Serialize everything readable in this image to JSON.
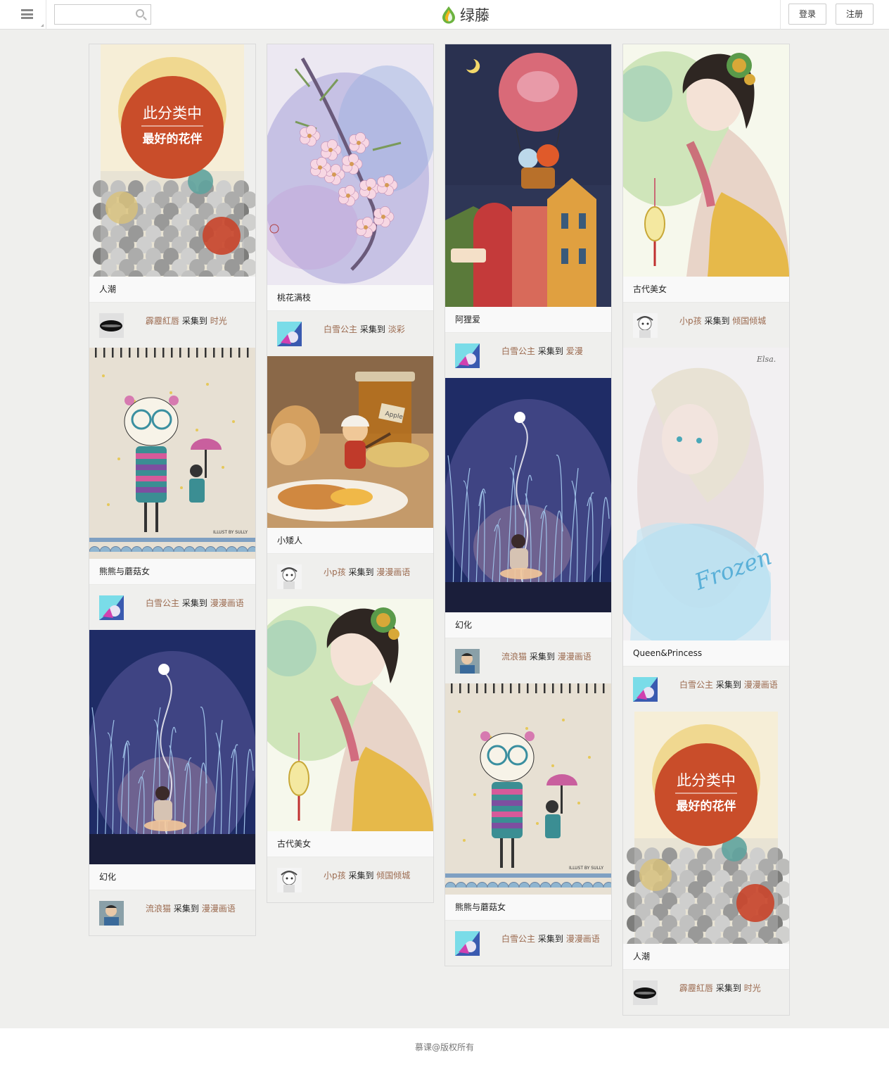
{
  "header": {
    "logo_text": "绿藤",
    "search_placeholder": "",
    "login_label": "登录",
    "register_label": "注册"
  },
  "collect_word": "采集到",
  "columns": [
    [
      {
        "art": "crowd",
        "title": "人潮",
        "user": "霹靂紅唇",
        "board": "时光",
        "avatar": "lips",
        "banner1": "此分类中",
        "banner2": "最好的花伴"
      },
      {
        "art": "bear",
        "title": "熊熊与蘑菇女",
        "user": "白雪公主",
        "board": "漫漫画语",
        "avatar": "blue",
        "sig": "ILLUST BY SULLY"
      },
      {
        "art": "night",
        "title": "幻化",
        "user": "流浪猫",
        "board": "漫漫画语",
        "avatar": "boy"
      }
    ],
    [
      {
        "art": "blossom",
        "title": "桃花满枝",
        "user": "白雪公主",
        "board": "淡彩",
        "avatar": "blue"
      },
      {
        "art": "kitchen",
        "title": "小矮人",
        "user": "小p孩",
        "board": "漫漫画语",
        "avatar": "sketch",
        "jar": "Apple"
      },
      {
        "art": "lady",
        "title": "古代美女",
        "user": "小p孩",
        "board": "倾国倾城",
        "avatar": "sketch"
      }
    ],
    [
      {
        "art": "balloon",
        "title": "阿狸爱",
        "user": "白雪公主",
        "board": "爱漫",
        "avatar": "blue"
      },
      {
        "art": "night",
        "title": "幻化",
        "user": "流浪猫",
        "board": "漫漫画语",
        "avatar": "boy"
      },
      {
        "art": "bear",
        "title": "熊熊与蘑菇女",
        "user": "白雪公主",
        "board": "漫漫画语",
        "avatar": "blue",
        "sig": "ILLUST BY SULLY"
      }
    ],
    [
      {
        "art": "lady",
        "title": "古代美女",
        "user": "小p孩",
        "board": "倾国倾城",
        "avatar": "sketch"
      },
      {
        "art": "frozen",
        "title": "Queen&Princess",
        "user": "白雪公主",
        "board": "漫漫画语",
        "avatar": "blue",
        "elsa": "Elsa.",
        "script": "Frozen"
      },
      {
        "art": "crowd",
        "title": "人潮",
        "user": "霹靂紅唇",
        "board": "时光",
        "avatar": "lips",
        "banner1": "此分类中",
        "banner2": "最好的花伴"
      }
    ]
  ],
  "footer": {
    "text": "慕课@版权所有"
  }
}
